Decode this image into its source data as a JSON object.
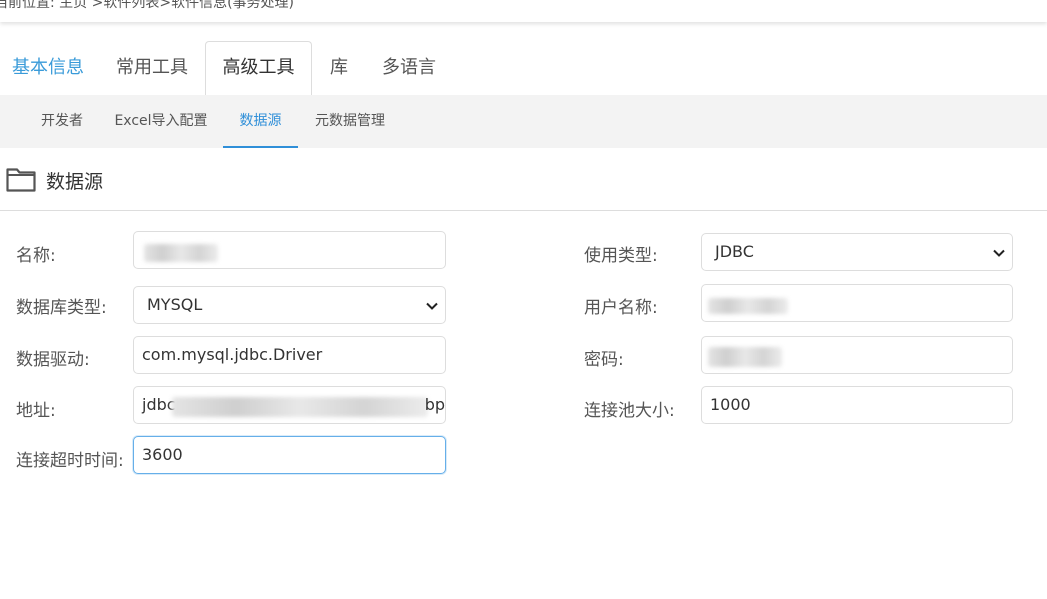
{
  "breadcrumb": "当前位置: 主页 >软件列表>软件信息(事务处理)",
  "main_tabs": [
    {
      "label": "基本信息"
    },
    {
      "label": "常用工具"
    },
    {
      "label": "高级工具"
    },
    {
      "label": "库"
    },
    {
      "label": "多语言"
    }
  ],
  "sub_tabs": [
    {
      "label": "开发者"
    },
    {
      "label": "Excel导入配置"
    },
    {
      "label": "数据源"
    },
    {
      "label": "元数据管理"
    }
  ],
  "section": {
    "title": "数据源",
    "icon": "folder-icon"
  },
  "form": {
    "name": {
      "label": "名称:",
      "value": ""
    },
    "usage_type": {
      "label": "使用类型:",
      "value": "JDBC"
    },
    "db_type": {
      "label": "数据库类型:",
      "value": "MYSQL"
    },
    "username": {
      "label": "用户名称:",
      "value": ""
    },
    "driver": {
      "label": "数据驱动:",
      "value": "com.mysql.jdbc.Driver"
    },
    "password": {
      "label": "密码:",
      "value": ""
    },
    "address": {
      "label": "地址:",
      "value_prefix": "jdbc",
      "value_suffix": "bp"
    },
    "pool_size": {
      "label": "连接池大小:",
      "value": "1000"
    },
    "timeout": {
      "label": "连接超时时间:",
      "value": "3600"
    }
  },
  "colors": {
    "accent": "#2f8fd8",
    "tab_blue": "#3a9bd9",
    "focus_border": "#66afe9"
  }
}
